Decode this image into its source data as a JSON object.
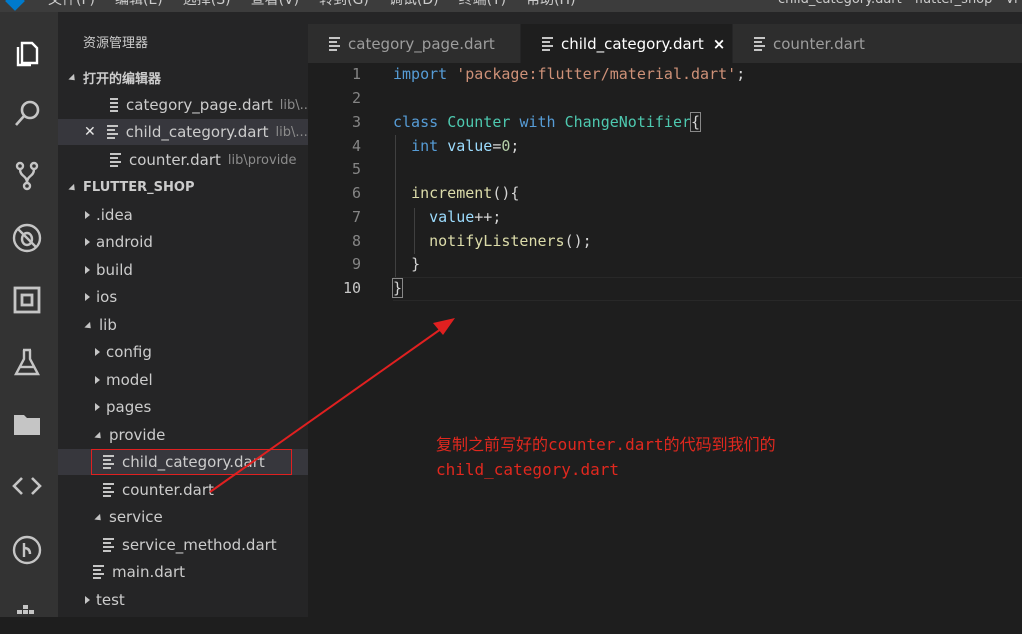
{
  "window": {
    "menu": [
      "文件(F)",
      "编辑(E)",
      "选择(S)",
      "查看(V)",
      "转到(G)",
      "调试(D)",
      "终端(T)",
      "帮助(H)"
    ],
    "title": "child_category.dart - flutter_shop - Vi"
  },
  "activity_bar": [
    "explorer-icon",
    "search-icon",
    "source-control-icon",
    "debug-icon",
    "extensions-icon",
    "flask-icon",
    "folder-icon",
    "code-icon",
    "git-lens-icon",
    "docker-icon"
  ],
  "sidebar": {
    "title": "资源管理器",
    "open_editors": {
      "label": "打开的编辑器",
      "items": [
        {
          "name": "category_page.dart",
          "path": "lib\\..."
        },
        {
          "name": "child_category.dart",
          "path": "lib\\..."
        },
        {
          "name": "counter.dart",
          "path": "lib\\provide"
        }
      ]
    },
    "project": {
      "label": "FLUTTER_SHOP",
      "items": [
        ".idea",
        "android",
        "build",
        "ios",
        "lib",
        "config",
        "model",
        "pages",
        "provide",
        "child_category.dart",
        "counter.dart",
        "service",
        "service_method.dart",
        "main.dart",
        "test"
      ]
    }
  },
  "tabs": [
    {
      "label": "category_page.dart"
    },
    {
      "label": "child_category.dart",
      "close": "×"
    },
    {
      "label": "counter.dart"
    }
  ],
  "editor": {
    "line_numbers": [
      "1",
      "2",
      "3",
      "4",
      "5",
      "6",
      "7",
      "8",
      "9",
      "10"
    ],
    "code": {
      "l1_kw": "import",
      "l1_str": "'package:flutter/material.dart'",
      "l1_end": ";",
      "l3_kw1": "class",
      "l3_cls1": "Counter",
      "l3_kw2": "with",
      "l3_cls2": "ChangeNotifier",
      "l3_brace": "{",
      "l4_kw": "int",
      "l4_var": "value",
      "l4_eq": "=",
      "l4_num": "0",
      "l4_end": ";",
      "l6_fn": "increment",
      "l6_rest": "(){",
      "l7_var": "value",
      "l7_rest": "++;",
      "l8_fn": "notifyListeners",
      "l8_rest": "();",
      "l9": "}",
      "l10": "}"
    }
  },
  "annotation": {
    "line1": "复制之前写好的counter.dart的代码到我们的",
    "line2": "child_category.dart",
    "color": "#e0281e"
  }
}
